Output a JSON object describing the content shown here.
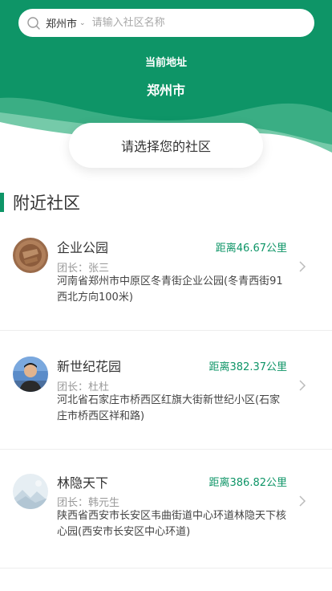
{
  "search": {
    "city": "郑州市",
    "placeholder": "请输入社区名称"
  },
  "current_address": {
    "label": "当前地址",
    "city": "郑州市"
  },
  "select_prompt": "请选择您的社区",
  "section_title": "附近社区",
  "labels": {
    "leader_prefix": "团长："
  },
  "communities": [
    {
      "name": "企业公园",
      "distance": "距离46.67公里",
      "leader": "团长：张三",
      "address": "河南省郑州市中原区冬青街企业公园(冬青西街91西北方向100米)",
      "avatar": "bronze-seal-photo"
    },
    {
      "name": "新世纪花园",
      "distance": "距离382.37公里",
      "leader": "团长：杜杜",
      "address": "河北省石家庄市桥西区红旗大街新世纪小区(石家庄市桥西区祥和路)",
      "avatar": "person-photo"
    },
    {
      "name": "林隐天下",
      "distance": "距离386.82公里",
      "leader": "团长：韩元生",
      "address": "陕西省西安市长安区韦曲街道中心环道林隐天下核心园(西安市长安区中心环道)",
      "avatar": "landscape-photo"
    }
  ],
  "colors": {
    "brand": "#0e9567",
    "distance": "#0e9567"
  }
}
